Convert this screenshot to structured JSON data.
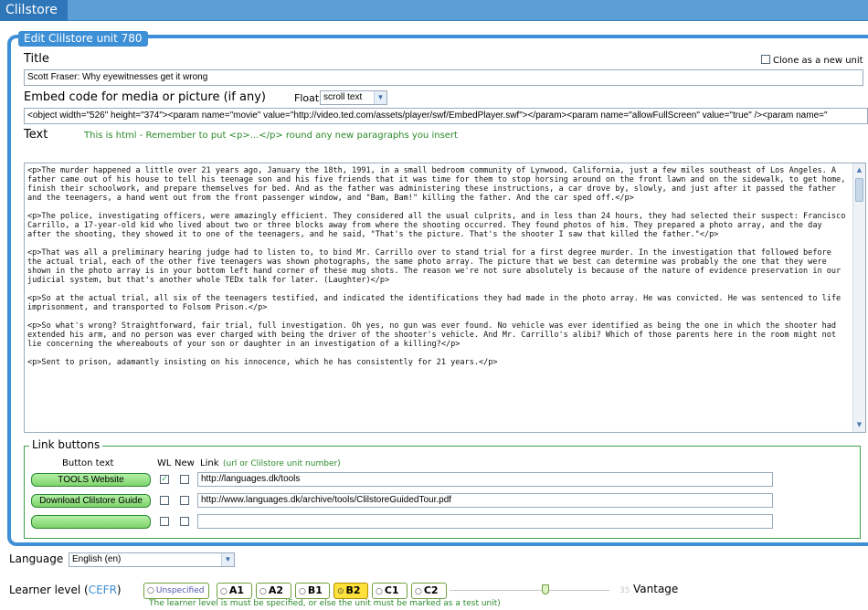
{
  "app": {
    "title": "Clilstore"
  },
  "page": {
    "legend": "Edit Clilstore unit 780"
  },
  "form": {
    "title_label": "Title",
    "clone_label": "Clone as a new unit",
    "title_value": "Scott Fraser: Why eyewitnesses get it wrong",
    "embed_label": "Embed code for media or picture (if any)",
    "float_label": "Float",
    "float_value": "scroll text",
    "embed_value": "<object width=\"526\" height=\"374\"><param name=\"movie\" value=\"http://video.ted.com/assets/player/swf/EmbedPlayer.swf\"></param><param name=\"allowFullScreen\" value=\"true\" /><param name=\"",
    "text_label": "Text",
    "text_hint": "This is html - Remember to put <p>...</p> round any new paragraphs you insert",
    "text_value": "<p>The murder happened a little over 21 years ago, January the 18th, 1991, in a small bedroom community of Lynwood, California, just a few miles southeast of Los Angeles. A father came out of his house to tell his teenage son and his five friends that it was time for them to stop horsing around on the front lawn and on the sidewalk, to get home, finish their schoolwork, and prepare themselves for bed. And as the father was administering these instructions, a car drove by, slowly, and just after it passed the father and the teenagers, a hand went out from the front passenger window, and \"Bam, Bam!\" killing the father. And the car sped off.</p>\n\n<p>The police, investigating officers, were amazingly efficient. They considered all the usual culprits, and in less than 24 hours, they had selected their suspect: Francisco Carrillo, a 17-year-old kid who lived about two or three blocks away from where the shooting occurred. They found photos of him. They prepared a photo array, and the day after the shooting, they showed it to one of the teenagers, and he said, \"That's the picture. That's the shooter I saw that killed the father.\"</p>\n\n<p>That was all a preliminary hearing judge had to listen to, to bind Mr. Carrillo over to stand trial for a first degree murder. In the investigation that followed before the actual trial, each of the other five teenagers was shown photographs, the same photo array. The picture that we best can determine was probably the one that they were shown in the photo array is in your bottom left hand corner of these mug shots. The reason we're not sure absolutely is because of the nature of evidence preservation in our judicial system, but that's another whole TEDx talk for later. (Laughter)</p>\n\n<p>So at the actual trial, all six of the teenagers testified, and indicated the identifications they had made in the photo array. He was convicted. He was sentenced to life imprisonment, and transported to Folsom Prison.</p>\n\n<p>So what's wrong? Straightforward, fair trial, full investigation. Oh yes, no gun was ever found. No vehicle was ever identified as being the one in which the shooter had extended his arm, and no person was ever charged with being the driver of the shooter's vehicle. And Mr. Carrillo's alibi? Which of those parents here in the room might not lie concerning the whereabouts of your son or daughter in an investigation of a killing?</p>\n\n<p>Sent to prison, adamantly insisting on his innocence, which he has consistently for 21 years.</p>"
  },
  "links": {
    "legend": "Link buttons",
    "col_button_text": "Button text",
    "col_wl": "WL",
    "col_new": "New",
    "col_link": "Link",
    "col_link_hint": "(url or Clilstore unit number)",
    "rows": [
      {
        "button_text": "TOOLS Website",
        "wl": true,
        "new": false,
        "url": "http://languages.dk/tools"
      },
      {
        "button_text": "Download Clilstore Guide",
        "wl": false,
        "new": false,
        "url": "http://www.languages.dk/archive/tools/ClilstoreGuidedTour.pdf"
      },
      {
        "button_text": "",
        "wl": false,
        "new": false,
        "url": ""
      }
    ]
  },
  "language": {
    "label": "Language",
    "value": "English (en)"
  },
  "level": {
    "label": "Learner level (",
    "label_link": "CEFR",
    "label_close": ")",
    "options": [
      "Unspecified",
      "A1",
      "A2",
      "B1",
      "B2",
      "C1",
      "C2"
    ],
    "selected": "B2",
    "slider_value": "35",
    "slider_label": "Vantage",
    "note": "The learner level is must be specified, or else the unit must be marked as a test unit)"
  },
  "colors": {
    "accent": "#3d8fd6",
    "green": "#3da04a",
    "selected": "#ffe13d"
  }
}
